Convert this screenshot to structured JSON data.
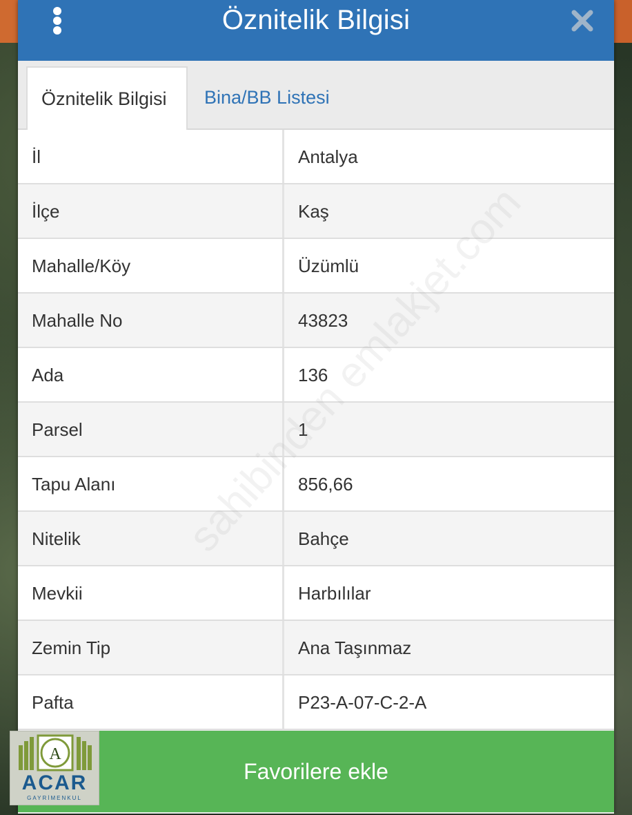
{
  "header": {
    "title": "Öznitelik Bilgisi",
    "menu_icon": "vertical-dots-icon",
    "close_icon": "close-icon"
  },
  "tabs": [
    {
      "label": "Öznitelik Bilgisi",
      "active": true
    },
    {
      "label": "Bina/BB Listesi",
      "active": false
    }
  ],
  "attributes": [
    {
      "key": "İl",
      "value": "Antalya"
    },
    {
      "key": "İlçe",
      "value": "Kaş"
    },
    {
      "key": "Mahalle/Köy",
      "value": "Üzümlü"
    },
    {
      "key": "Mahalle No",
      "value": "43823"
    },
    {
      "key": "Ada",
      "value": "136"
    },
    {
      "key": "Parsel",
      "value": "1"
    },
    {
      "key": "Tapu Alanı",
      "value": "856,66"
    },
    {
      "key": "Nitelik",
      "value": "Bahçe"
    },
    {
      "key": "Mevkii",
      "value": "Harbılılar"
    },
    {
      "key": "Zemin Tip",
      "value": "Ana Taşınmaz"
    },
    {
      "key": "Pafta",
      "value": "P23-A-07-C-2-A"
    }
  ],
  "favorite_button": {
    "label": "Favorilere ekle"
  },
  "logo": {
    "name": "ACAR",
    "subtitle": "GAYRİMENKUL",
    "letter": "A"
  },
  "watermark": "sahibinden emlakjet.com",
  "colors": {
    "header": "#2f73b6",
    "button": "#57b556",
    "tab_link": "#2f73b6"
  }
}
